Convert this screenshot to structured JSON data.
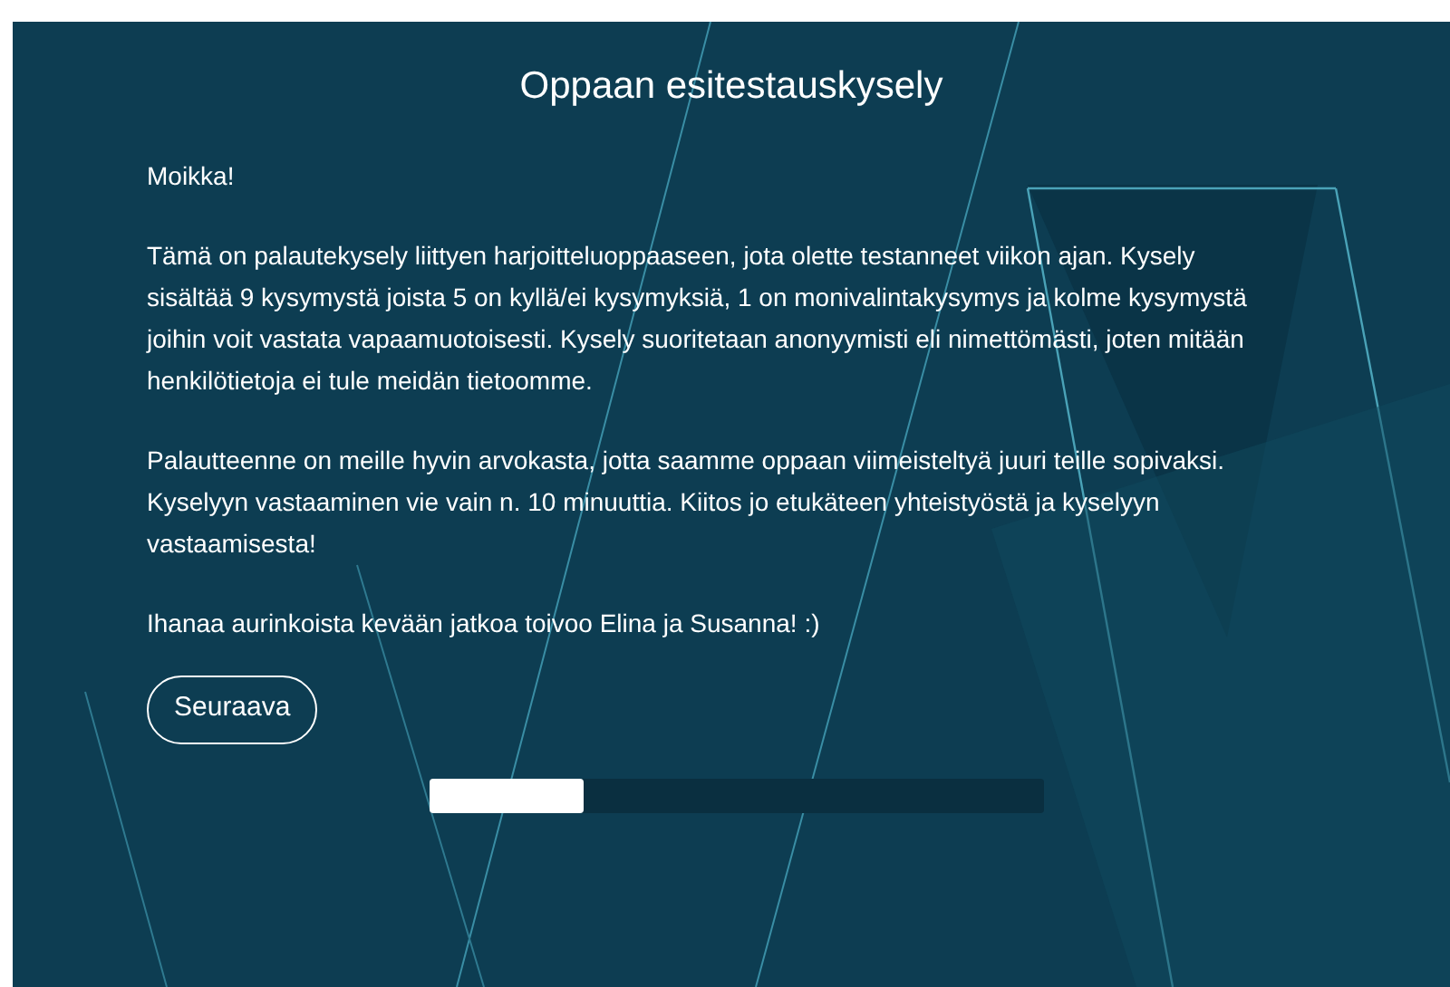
{
  "title": "Oppaan esitestauskysely",
  "paragraphs": [
    "Moikka!",
    "Tämä on palautekysely liittyen harjoitteluoppaaseen, jota olette testanneet viikon ajan. Kysely sisältää 9 kysymystä joista 5 on kyllä/ei kysymyksiä, 1 on monivalintakysymys ja kolme kysymystä joihin voit vastata vapaamuotoisesti. Kysely suoritetaan anonyymisti eli nimettömästi, joten mitään henkilötietoja ei tule meidän tietoomme.",
    "Palautteenne on meille hyvin arvokasta, jotta saamme oppaan viimeisteltyä juuri teille sopivaksi. Kyselyyn vastaaminen vie vain n. 10 minuuttia. Kiitos jo etukäteen yhteistyöstä ja kyselyyn vastaamisesta!",
    "Ihanaa aurinkoista kevään jatkoa toivoo Elina ja Susanna! :)"
  ],
  "next_button": "Seuraava",
  "progress": {
    "level": 0.25
  }
}
